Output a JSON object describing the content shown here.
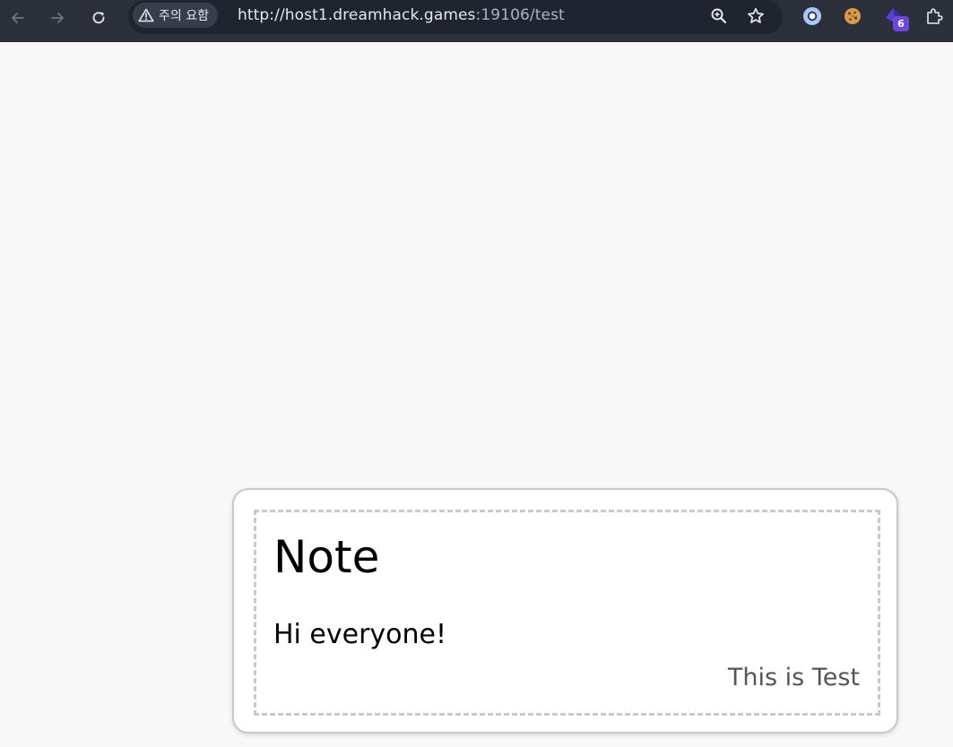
{
  "browser": {
    "security_label": "주의 요함",
    "url_host": "http://host1.dreamhack.games",
    "url_rest": ":19106/test",
    "extension_badge": "6",
    "icons": {
      "back": "back-arrow-icon",
      "forward": "forward-arrow-icon",
      "reload": "reload-icon",
      "warning": "warning-icon",
      "zoom": "zoom-icon",
      "bookmark": "star-icon",
      "ext1": "circle-extension-icon",
      "ext2": "cookie-icon",
      "ext3": "gem-extension-icon",
      "extensions": "puzzle-icon"
    },
    "colors": {
      "toolbar": "#2b303b",
      "omnibox": "#1f2430",
      "badge": "#6f46d9"
    }
  },
  "note": {
    "title": "Note",
    "body": "Hi everyone!",
    "footer": "This is Test"
  }
}
